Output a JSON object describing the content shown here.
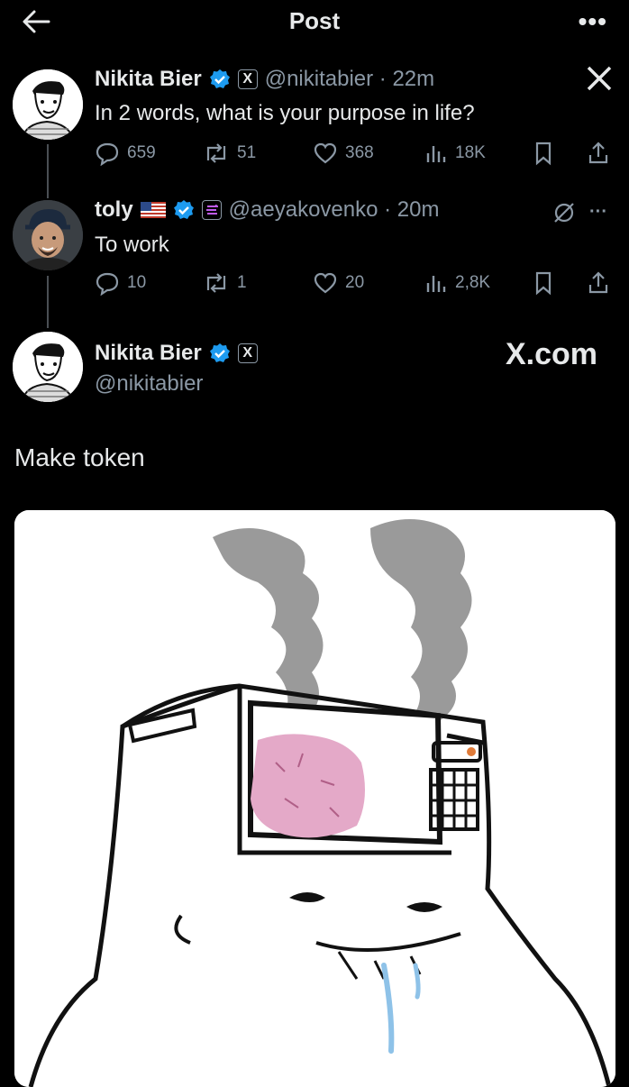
{
  "header": {
    "title": "Post"
  },
  "tweet1": {
    "name": "Nikita Bier",
    "badge": "X",
    "handle_time": "@nikitabier · 22m",
    "text": "In 2 words, what is your purpose in life?",
    "replies": "659",
    "reposts": "51",
    "likes": "368",
    "views": "18K"
  },
  "tweet2": {
    "name": "toly",
    "handle_time": "@aeyakovenko · 20m",
    "text": "To work",
    "replies": "10",
    "reposts": "1",
    "likes": "20",
    "views": "2,8K"
  },
  "tweet3": {
    "name": "Nikita Bier",
    "badge": "X",
    "handle": "@nikitabier",
    "watermark": "X.com",
    "text": "Make token"
  },
  "colors": {
    "background": "#000000",
    "muted": "#8b98a5",
    "verified": "#1d9bf0",
    "text": "#e7e9ea"
  },
  "icons": [
    "back-arrow-icon",
    "more-icon",
    "x-logo-icon",
    "verified-icon",
    "reply-icon",
    "repost-icon",
    "like-icon",
    "views-icon",
    "bookmark-icon",
    "share-icon",
    "flag-us-icon",
    "solana-icon",
    "grok-icon"
  ]
}
